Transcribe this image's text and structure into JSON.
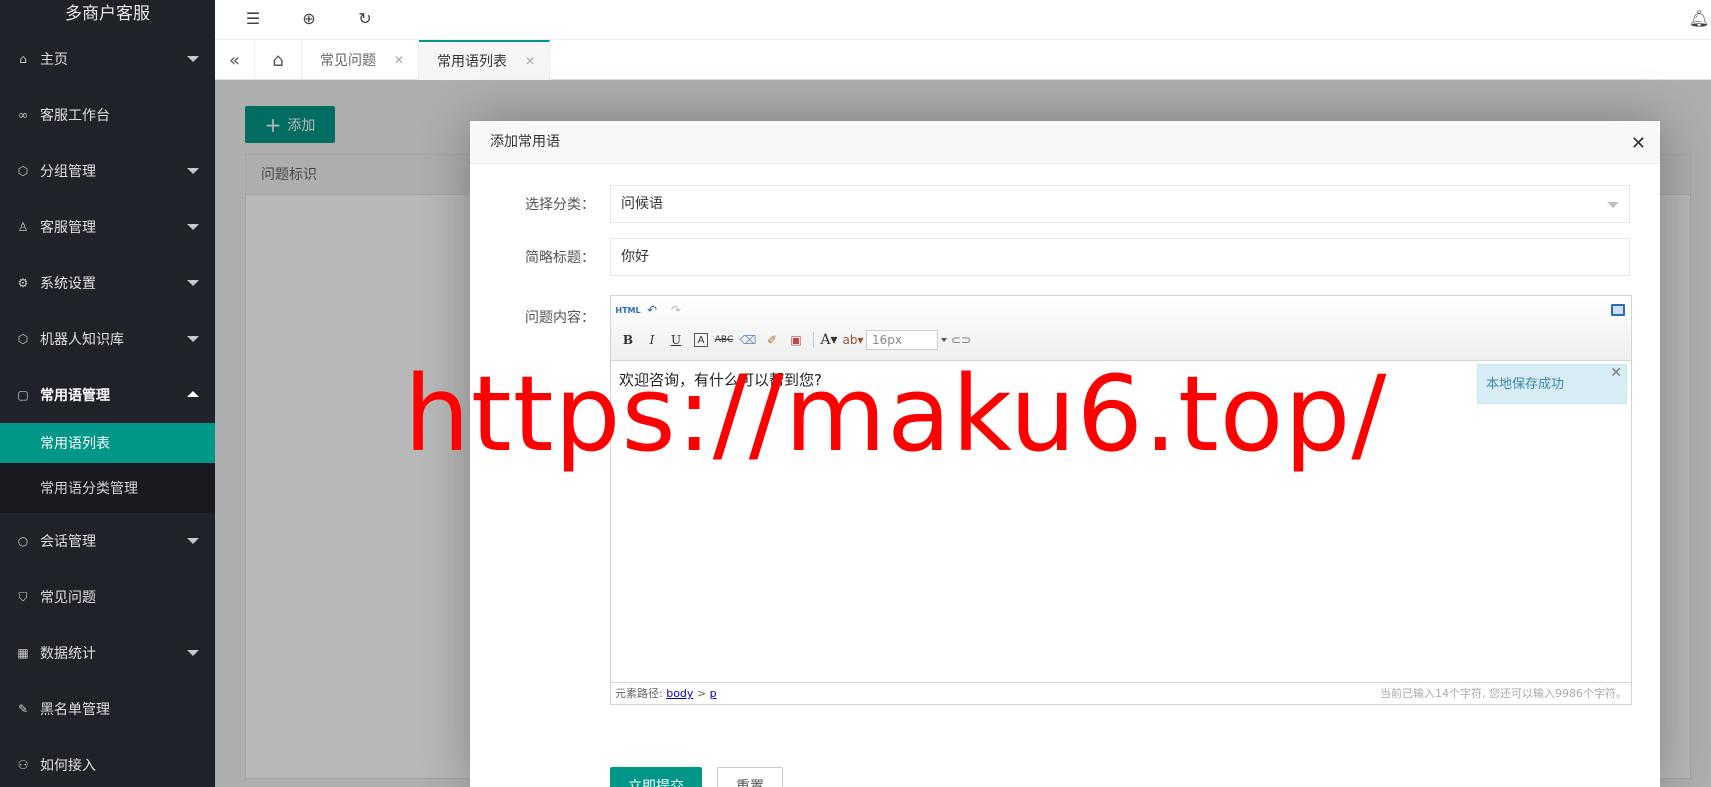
{
  "sidebar": {
    "brand": "多商户客服",
    "items": [
      {
        "label": "主页",
        "icon": "home-icon"
      },
      {
        "label": "客服工作台",
        "icon": "infinity-icon"
      },
      {
        "label": "分组管理",
        "icon": "cube-icon"
      },
      {
        "label": "客服管理",
        "icon": "user-icon"
      },
      {
        "label": "系统设置",
        "icon": "gear-icon"
      },
      {
        "label": "机器人知识库",
        "icon": "cube-icon"
      },
      {
        "label": "常用语管理",
        "icon": "note-icon"
      },
      {
        "label": "会话管理",
        "icon": "chat-icon"
      },
      {
        "label": "常见问题",
        "icon": "shield-icon"
      },
      {
        "label": "数据统计",
        "icon": "grid-icon"
      },
      {
        "label": "黑名单管理",
        "icon": "edit-icon"
      },
      {
        "label": "如何接入",
        "icon": "link-icon"
      }
    ],
    "sub_items": [
      "常用语列表",
      "常用语分类管理"
    ]
  },
  "tabs": [
    {
      "label": "常见问题"
    },
    {
      "label": "常用语列表"
    }
  ],
  "content": {
    "add_button": "添加",
    "table_header": "问题标识"
  },
  "modal": {
    "title": "添加常用语",
    "category_label": "选择分类：",
    "category_value": "问候语",
    "title_label": "简略标题：",
    "title_value": "你好",
    "content_label": "问题内容：",
    "editor_text": "欢迎咨询，有什么可以帮到您?",
    "font_size": "16px",
    "path_label": "元素路径:",
    "path_body": "body",
    "path_sep": ">",
    "path_p": "p",
    "char_count": "当前已输入14个字符, 您还可以输入9986个字符。",
    "toast": "本地保存成功",
    "submit_button": "立即提交",
    "reset_button": "重置"
  },
  "watermark": "https://maku6.top/",
  "colors": {
    "accent": "#009688",
    "sidebar": "#20222a",
    "watermark": "#ff0000"
  }
}
